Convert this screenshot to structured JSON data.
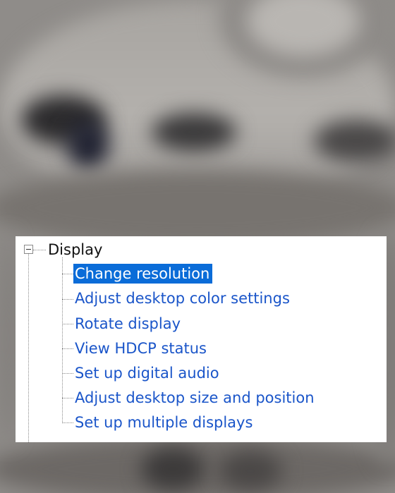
{
  "tree": {
    "root": {
      "label": "Display",
      "expanded": true,
      "icon": "collapse-minus-icon"
    },
    "items": [
      {
        "label": "Change resolution",
        "selected": true
      },
      {
        "label": "Adjust desktop color settings",
        "selected": false
      },
      {
        "label": "Rotate display",
        "selected": false
      },
      {
        "label": "View HDCP status",
        "selected": false
      },
      {
        "label": "Set up digital audio",
        "selected": false
      },
      {
        "label": "Adjust desktop size and position",
        "selected": false
      },
      {
        "label": "Set up multiple displays",
        "selected": false
      }
    ]
  },
  "colors": {
    "link": "#1a55c9",
    "selection": "#0a6cd8",
    "panel_bg": "#ffffff"
  }
}
